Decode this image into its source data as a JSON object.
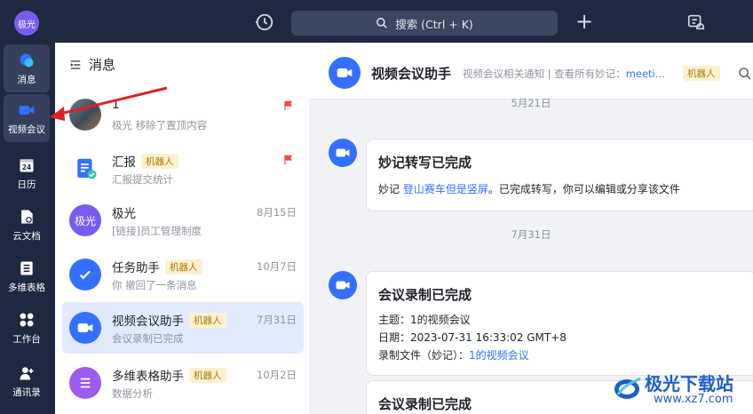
{
  "topbar": {
    "avatar_text": "极光",
    "search_placeholder": "搜索 (Ctrl + K)"
  },
  "sidebar": {
    "items": [
      {
        "label": "消息",
        "icon": "chat-bubble-icon"
      },
      {
        "label": "视频会议",
        "icon": "video-camera-icon"
      },
      {
        "label": "日历",
        "icon": "calendar-icon"
      },
      {
        "label": "云文档",
        "icon": "cloud-doc-icon"
      },
      {
        "label": "多维表格",
        "icon": "table-icon"
      },
      {
        "label": "工作台",
        "icon": "apps-grid-icon"
      },
      {
        "label": "通讯录",
        "icon": "contacts-icon"
      }
    ]
  },
  "panel": {
    "title": "消息",
    "conversations": [
      {
        "name": "1",
        "sub": "极光 移除了置顶内容",
        "date": "",
        "badge": "",
        "flagged": true
      },
      {
        "name": "汇报",
        "sub": "汇报提交统计",
        "date": "",
        "badge": "机器人",
        "flagged": true
      },
      {
        "name": "极光",
        "sub": "[链接]员工管理制度",
        "date": "8月15日",
        "badge": "",
        "flagged": false,
        "avatar_text": "极光"
      },
      {
        "name": "任务助手",
        "sub": "你 撤回了一条消息",
        "date": "10月7日",
        "badge": "机器人",
        "flagged": false
      },
      {
        "name": "视频会议助手",
        "sub": "会议录制已完成",
        "date": "7月31日",
        "badge": "机器人",
        "flagged": false
      },
      {
        "name": "多维表格助手",
        "sub": "数据分析",
        "date": "10月2日",
        "badge": "机器人",
        "flagged": false
      }
    ]
  },
  "chat": {
    "title": "视频会议助手",
    "desc_prefix": "视频会议相关通知 | 查看所有妙记：",
    "desc_link": "meeti...",
    "badge": "机器人",
    "date_top": "5月21日",
    "date_mid": "7月31日",
    "card1": {
      "title": "妙记转写已完成",
      "prefix": "妙记 ",
      "link": "登山赛车但是竖屏",
      "suffix": "。已完成转写，你可以编辑或分享该文件"
    },
    "card2": {
      "title": "会议录制已完成",
      "topic": "主题：1的视频会议",
      "date": "日期：2023-07-31 16:33:02 GMT+8",
      "file_prefix": "录制文件（妙记）：",
      "file_link": "1的视频会议"
    },
    "card3": {
      "title": "会议录制已完成"
    }
  },
  "watermark": {
    "brand": "极光下载站",
    "url": "www.xz7.com"
  },
  "colors": {
    "sidebar_bg": "#1e2840",
    "accent": "#3370ff",
    "selected_bg": "#e1eaff",
    "flag": "#f54a45",
    "annotation_arrow": "#e02020"
  }
}
